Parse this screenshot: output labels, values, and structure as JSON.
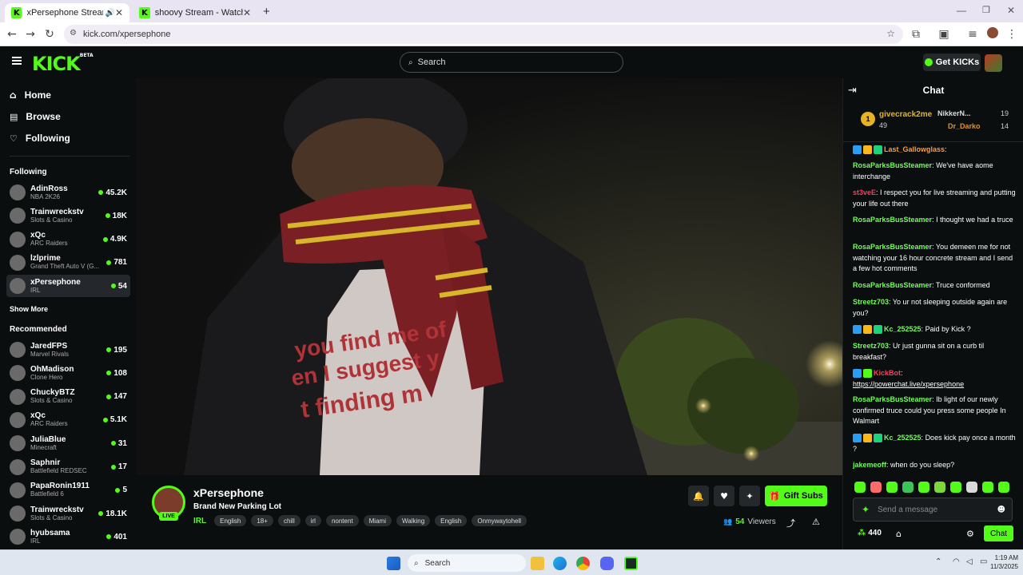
{
  "browser": {
    "tabs": [
      {
        "title": "xPersephone Stream - Watc"
      },
      {
        "title": "shoovy Stream - Watch Live on"
      }
    ],
    "url": "kick.com/xpersephone"
  },
  "header": {
    "logo": "KICK",
    "logo_badge": "BETA",
    "search_placeholder": "Search",
    "get_kicks": "Get KICKs"
  },
  "sidebar": {
    "nav": [
      {
        "label": "Home"
      },
      {
        "label": "Browse"
      },
      {
        "label": "Following"
      }
    ],
    "following_heading": "Following",
    "following": [
      {
        "name": "AdinRoss",
        "game": "NBA 2K26",
        "viewers": "45.2K"
      },
      {
        "name": "Trainwreckstv",
        "game": "Slots & Casino",
        "viewers": "18K"
      },
      {
        "name": "xQc",
        "game": "ARC Raiders",
        "viewers": "4.9K"
      },
      {
        "name": "lzlprime",
        "game": "Grand Theft Auto V (G...",
        "viewers": "781"
      },
      {
        "name": "xPersephone",
        "game": "IRL",
        "viewers": "54"
      }
    ],
    "show_more": "Show More",
    "recommended_heading": "Recommended",
    "recommended": [
      {
        "name": "JaredFPS",
        "game": "Marvel Rivals",
        "viewers": "195"
      },
      {
        "name": "OhMadison",
        "game": "Clone Hero",
        "viewers": "108"
      },
      {
        "name": "ChuckyBTZ",
        "game": "Slots & Casino",
        "viewers": "147"
      },
      {
        "name": "xQc",
        "game": "ARC Raiders",
        "viewers": "5.1K"
      },
      {
        "name": "JuliaBlue",
        "game": "Minecraft",
        "viewers": "31"
      },
      {
        "name": "Saphnir",
        "game": "Battlefield REDSEC",
        "viewers": "17"
      },
      {
        "name": "PapaRonin1911",
        "game": "Battlefield 6",
        "viewers": "5"
      },
      {
        "name": "Trainwreckstv",
        "game": "Slots & Casino",
        "viewers": "18.1K"
      },
      {
        "name": "hyubsama",
        "game": "IRL",
        "viewers": "401"
      }
    ]
  },
  "stream": {
    "live_label": "LIVE",
    "channel": "xPersephone",
    "title": "Brand New Parking Lot",
    "category": "IRL",
    "tags": [
      "English",
      "18+",
      "chill",
      "irl",
      "nontent",
      "Miami",
      "Walking",
      "English",
      "Onmywaytohell"
    ],
    "gift_subs": "Gift Subs",
    "viewers": "54",
    "viewers_label": "Viewers",
    "shirt_text": [
      "you find me of",
      "en I suggest y",
      "t finding m"
    ]
  },
  "chat": {
    "title": "Chat",
    "leaderboard": {
      "rank": "1",
      "top_name": "givecrack2me",
      "top_count": "49",
      "second_name": "NikkerN...",
      "second_count": "19",
      "third_name": "Dr_Darko",
      "third_count": "14"
    },
    "messages": [
      {
        "user": "Last_Gallowglass",
        "text": "",
        "color": "#ff9a3c"
      },
      {
        "user": "RosaParksBusSteamer",
        "text": "We've have aome interchange",
        "color": "#72fc5a"
      },
      {
        "user": "st3veE",
        "text": "I respect you for live streaming and putting your life out there",
        "color": "#ff3b5c"
      },
      {
        "user": "RosaParksBusSteamer",
        "text": "I thought we had a truce",
        "color": "#72fc5a"
      },
      {
        "user": "RosaParksBusSteamer",
        "text": "You demeen me for not watching your 16 hour concrete stream and I send a few hot comments",
        "color": "#72fc5a"
      },
      {
        "user": "RosaParksBusSteamer",
        "text": "Truce conformed",
        "color": "#72fc5a"
      },
      {
        "user": "Streetz703",
        "text": "Yo ur not sleeping outside again are you?",
        "color": "#72fc5a"
      },
      {
        "user": "Kc_252525",
        "text": "Paid by Kick ?",
        "color": "#72fc5a"
      },
      {
        "user": "Streetz703",
        "text": "Ur just gunna sit on a curb til breakfast?",
        "color": "#72fc5a"
      },
      {
        "user": "KickBot",
        "text": "https://powerchat.live/xpersephone",
        "color": "#ff3b5c"
      },
      {
        "user": "RosaParksBusSteamer",
        "text": "Ib light of our newly confirmed truce could you press some people In Walmart",
        "color": "#72fc5a"
      },
      {
        "user": "Kc_252525",
        "text": "Does kick pay once a month ?",
        "color": "#72fc5a"
      },
      {
        "user": "jakemeoff",
        "text": "when do you sleep?",
        "color": "#72fc5a"
      }
    ],
    "input_placeholder": "Send a message",
    "points": "440",
    "chat_button": "Chat"
  },
  "taskbar": {
    "search": "Search",
    "time": "1:19 AM",
    "date": "11/3/2025"
  },
  "colors": {
    "brand": "#53fc18",
    "background": "#0b0e0f"
  }
}
